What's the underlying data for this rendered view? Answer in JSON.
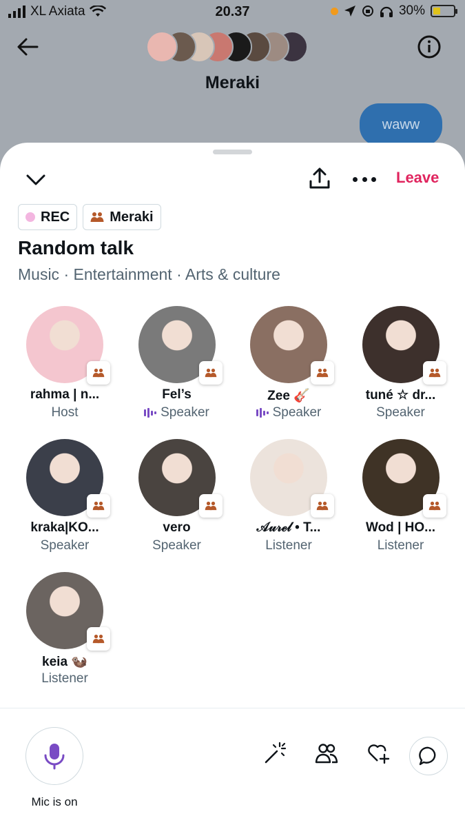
{
  "status_bar": {
    "carrier": "XL Axiata",
    "time": "20.37",
    "battery": "30%",
    "battery_level": 0.3
  },
  "dm_header": {
    "title": "Meraki",
    "last_message": "waww",
    "avatar_colors": [
      "#e9b7b0",
      "#6b5a4e",
      "#d8c6b8",
      "#c97870",
      "#1a1a1a",
      "#5a4a40",
      "#9d8b82",
      "#3b3340"
    ]
  },
  "space": {
    "leave_label": "Leave",
    "rec_label": "REC",
    "community_label": "Meraki",
    "title": "Random talk",
    "topics": "Music · Entertainment · Arts & culture"
  },
  "participants": [
    {
      "name": "rahma | n...",
      "role": "Host",
      "speaking": false,
      "avatar_color": "#f4c6cf"
    },
    {
      "name": "Fel’s",
      "role": "Speaker",
      "speaking": true,
      "avatar_color": "#7a7a7a"
    },
    {
      "name": "Zee 🎸",
      "role": "Speaker",
      "speaking": true,
      "avatar_color": "#8a6f62"
    },
    {
      "name": "tuné ☆ dr...",
      "role": "Speaker",
      "speaking": false,
      "avatar_color": "#3d302c"
    },
    {
      "name": "kraka|KO...",
      "role": "Speaker",
      "speaking": false,
      "avatar_color": "#3b3f4a"
    },
    {
      "name": "vero",
      "role": "Speaker",
      "speaking": false,
      "avatar_color": "#4a4440"
    },
    {
      "name": "𝒜𝓊𝓇ℯ𝓁 • T...",
      "role": "Listener",
      "speaking": false,
      "avatar_color": "#ece3dc"
    },
    {
      "name": "Wod | HO...",
      "role": "Listener",
      "speaking": false,
      "avatar_color": "#3f3326"
    },
    {
      "name": "keia 🦦",
      "role": "Listener",
      "speaking": false,
      "avatar_color": "#6b6460"
    }
  ],
  "footer": {
    "mic_label": "Mic is on"
  },
  "colors": {
    "leave": "#e0245e",
    "accent_purple": "#794bc4",
    "community_badge": "#b5592a"
  }
}
